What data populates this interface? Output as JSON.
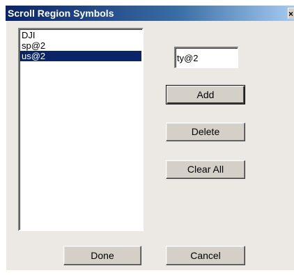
{
  "window": {
    "title": "Scroll Region Symbols",
    "close_glyph": "×"
  },
  "symbols_list": {
    "items": [
      "DJI",
      "sp@2",
      "us@2"
    ],
    "selected_index": 2
  },
  "symbol_input": {
    "value": "ty@2",
    "placeholder": ""
  },
  "buttons": {
    "add": "Add",
    "delete": "Delete",
    "clear_all": "Clear All",
    "done": "Done",
    "cancel": "Cancel"
  },
  "colors": {
    "titlebar_start": "#0a246a",
    "titlebar_end": "#a6caf0",
    "selection": "#0a246a",
    "dialog_face": "#ece9e4"
  }
}
